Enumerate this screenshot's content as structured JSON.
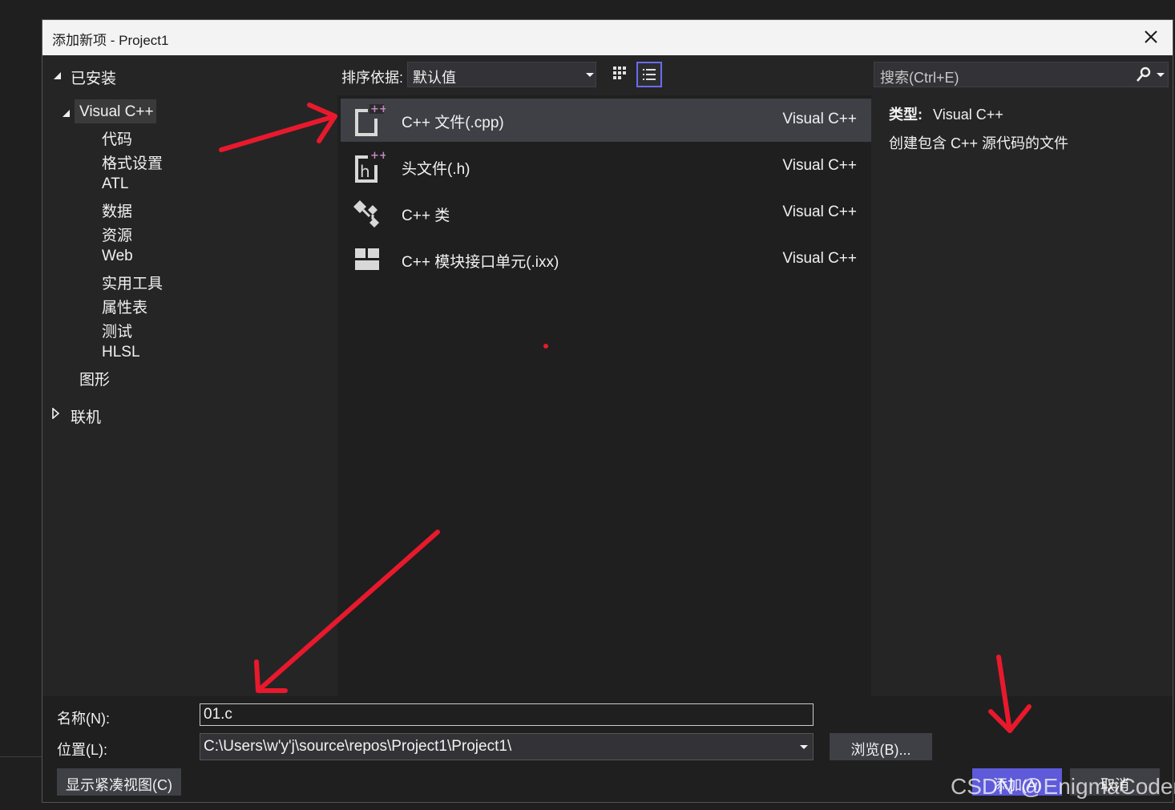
{
  "dialog": {
    "title": "添加新项 - Project1"
  },
  "tree": {
    "installed": "已安装",
    "visual_cpp": "Visual C++",
    "children": [
      "代码",
      "格式设置",
      "ATL",
      "数据",
      "资源",
      "Web",
      "实用工具",
      "属性表",
      "测试",
      "HLSL"
    ],
    "graphics": "图形",
    "online": "联机"
  },
  "sort": {
    "label": "排序依据:",
    "value": "默认值"
  },
  "templates": [
    {
      "name": "C++ 文件(.cpp)",
      "lang": "Visual C++",
      "icon": "cpp-file-icon",
      "selected": true
    },
    {
      "name": "头文件(.h)",
      "lang": "Visual C++",
      "icon": "header-file-icon",
      "selected": false
    },
    {
      "name": "C++ 类",
      "lang": "Visual C++",
      "icon": "cpp-class-icon",
      "selected": false
    },
    {
      "name": "C++ 模块接口单元(.ixx)",
      "lang": "Visual C++",
      "icon": "module-interface-icon",
      "selected": false
    }
  ],
  "search": {
    "placeholder": "搜索(Ctrl+E)"
  },
  "details": {
    "type_label": "类型:",
    "type_value": "Visual C++",
    "description": "创建包含 C++ 源代码的文件"
  },
  "form": {
    "name_label": "名称(N):",
    "name_value": "01.c",
    "location_label": "位置(L):",
    "location_value": "C:\\Users\\w'y'j\\source\\repos\\Project1\\Project1\\",
    "browse_label": "浏览(B)...",
    "compact_label": "显示紧凑视图(C)",
    "add_label": "添加(A)",
    "cancel_label": "取消"
  },
  "watermark": "CSDN @EnigmaCoder",
  "colors": {
    "accent": "#5e5ad9",
    "annotation": "#e8192c",
    "selected": "#3f3f46"
  }
}
